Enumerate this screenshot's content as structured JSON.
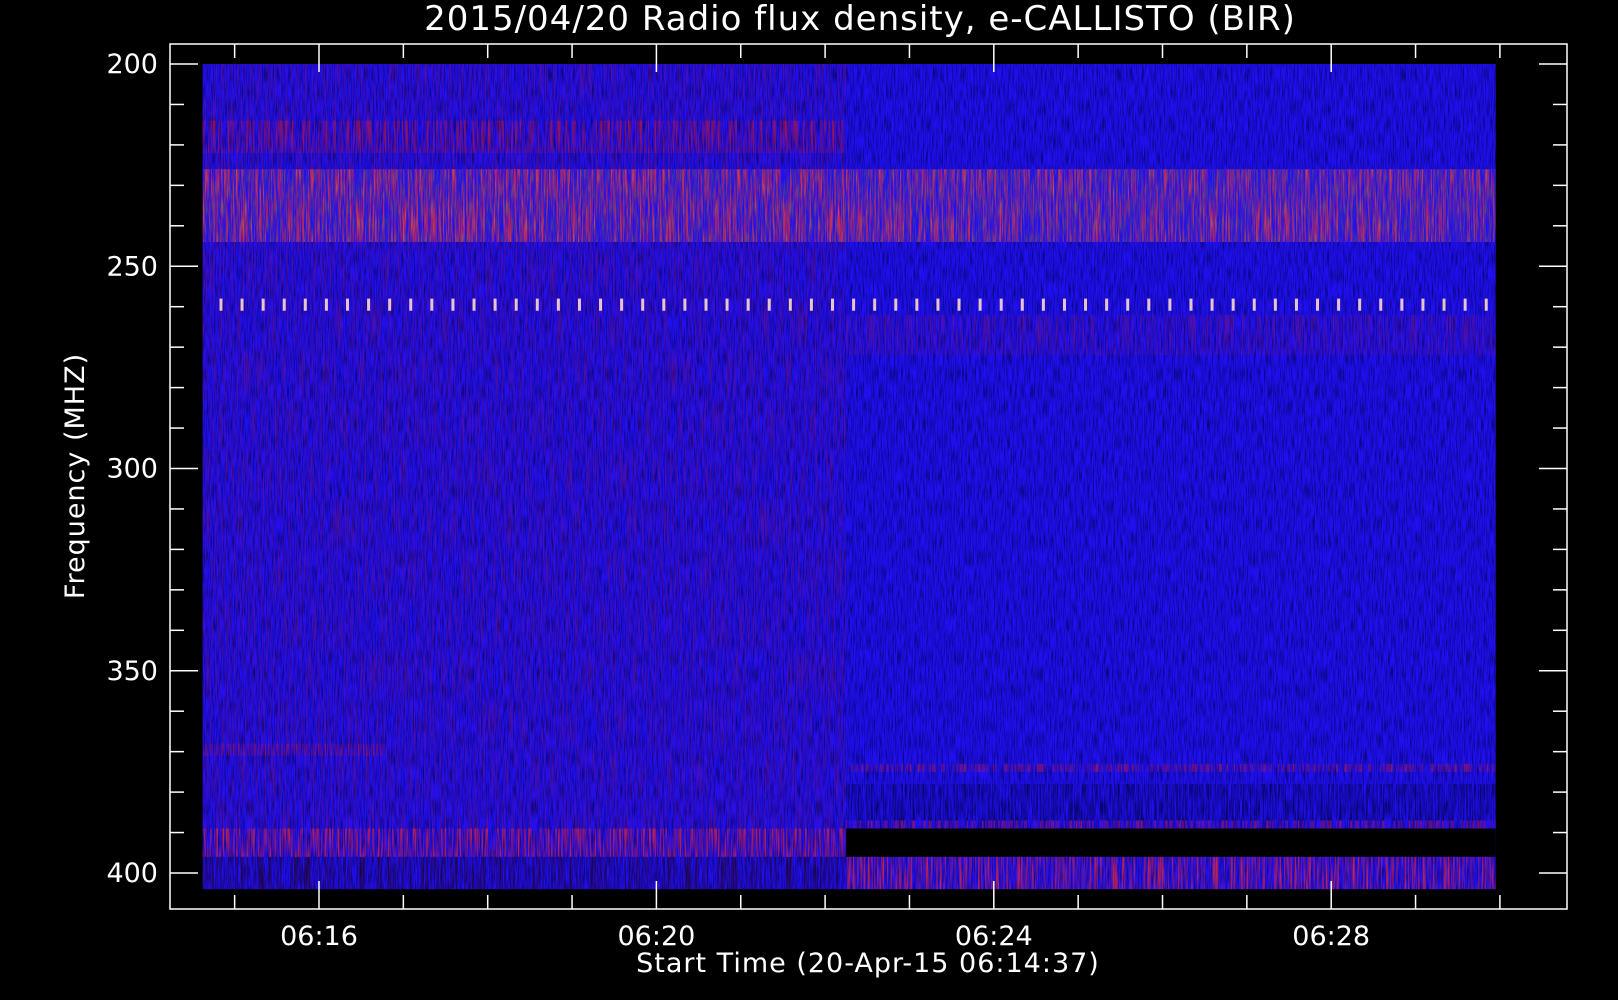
{
  "chart_data": {
    "type": "heatmap",
    "title": "2015/04/20  Radio flux density, e-CALLISTO (BIR)",
    "xlabel": "Start Time (20-Apr-15 06:14:37)",
    "ylabel": "Frequency (MHZ)",
    "x_tick_labels": [
      "06:16",
      "06:20",
      "06:24",
      "06:28"
    ],
    "x_tick_minutes": [
      16,
      20,
      24,
      28
    ],
    "y_tick_labels": [
      "200",
      "250",
      "300",
      "350",
      "400"
    ],
    "y_tick_values": [
      200,
      250,
      300,
      350,
      400
    ],
    "xlim_minutes": [
      14.0,
      30.0
    ],
    "ylim": [
      405,
      195
    ],
    "data_extent": {
      "start_minute": 14.62,
      "end_minute": 29.95,
      "freq_min": 200,
      "freq_max": 404
    },
    "segment_break_minute": 22.25,
    "grid": false,
    "colormap": [
      "#000000",
      "#1a00c8",
      "#2a10ff",
      "#c01010",
      "#ff3020",
      "#ffe0c0"
    ],
    "features": [
      {
        "name": "band",
        "freq": [
          226,
          244
        ],
        "minutes": [
          14.62,
          29.95
        ],
        "level": "red-bright"
      },
      {
        "name": "band",
        "freq": [
          214,
          222
        ],
        "minutes": [
          14.62,
          22.25
        ],
        "level": "red"
      },
      {
        "name": "dotted-line",
        "freq": [
          258,
          261
        ],
        "minutes": [
          14.62,
          29.95
        ],
        "level": "white"
      },
      {
        "name": "band",
        "freq": [
          262,
          272
        ],
        "minutes": [
          22.25,
          29.95
        ],
        "level": "red-faint"
      },
      {
        "name": "band",
        "freq": [
          368,
          371
        ],
        "minutes": [
          14.62,
          16.8
        ],
        "level": "red"
      },
      {
        "name": "band",
        "freq": [
          373,
          375
        ],
        "minutes": [
          22.25,
          29.95
        ],
        "level": "red"
      },
      {
        "name": "band",
        "freq": [
          389,
          396
        ],
        "minutes": [
          14.62,
          22.25
        ],
        "level": "red-bright"
      },
      {
        "name": "band",
        "freq": [
          396,
          404
        ],
        "minutes": [
          14.62,
          22.25
        ],
        "level": "dark"
      },
      {
        "name": "band",
        "freq": [
          387,
          389
        ],
        "minutes": [
          22.25,
          29.95
        ],
        "level": "red"
      },
      {
        "name": "gap",
        "freq": [
          389,
          396
        ],
        "minutes": [
          22.25,
          29.95
        ],
        "level": "black"
      },
      {
        "name": "band",
        "freq": [
          396,
          404
        ],
        "minutes": [
          22.25,
          29.95
        ],
        "level": "red-bright"
      },
      {
        "name": "band",
        "freq": [
          378,
          387
        ],
        "minutes": [
          22.25,
          29.95
        ],
        "level": "dark"
      }
    ]
  }
}
